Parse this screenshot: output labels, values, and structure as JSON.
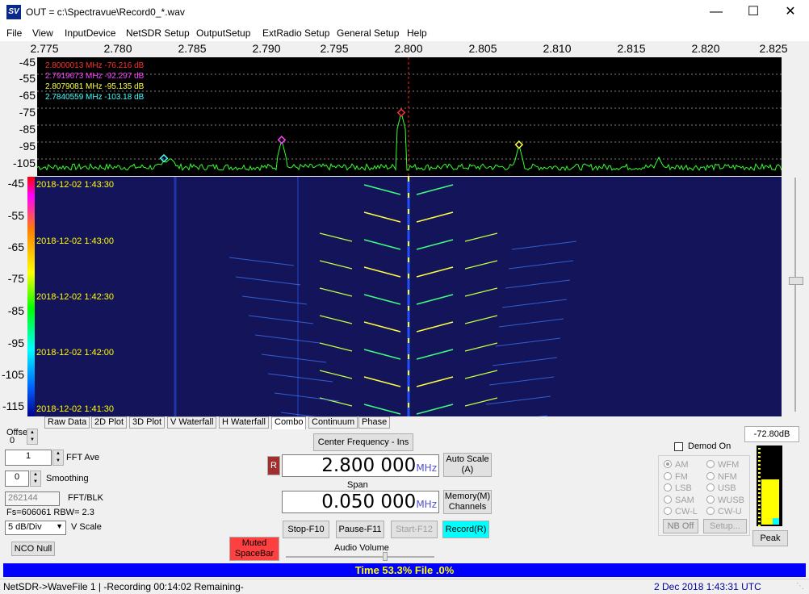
{
  "window": {
    "title": "OUT = c:\\Spectravue\\Record0_*.wav",
    "icon": "spectravue-app-icon",
    "icon_text": "SV"
  },
  "menu": [
    "File",
    "View",
    "InputDevice",
    "NetSDR Setup",
    "OutputSetup",
    "ExtRadio Setup",
    "General Setup",
    "Help"
  ],
  "freq_axis": {
    "ticks": [
      "2.775",
      "2.780",
      "2.785",
      "2.790",
      "2.795",
      "2.800",
      "2.805",
      "2.810",
      "2.815",
      "2.820",
      "2.825"
    ]
  },
  "spectrum": {
    "db_labels": [
      "-45",
      "-55",
      "-65",
      "-75",
      "-85",
      "-95",
      "-105"
    ],
    "markers": [
      {
        "text": "2.8000013 MHz  -76.216 dB",
        "color": "#ff3030",
        "freq": 2.8000013,
        "db": -76.216
      },
      {
        "text": "2.7919673 MHz  -92.297 dB",
        "color": "#ff40ff",
        "freq": 2.7919673,
        "db": -92.297
      },
      {
        "text": "2.8079081 MHz  -95.135 dB",
        "color": "#ffff40",
        "freq": 2.8079081,
        "db": -95.135
      },
      {
        "text": "2.7840559 MHz  -103.18 dB",
        "color": "#40ffff",
        "freq": 2.7840559,
        "db": -103.18
      }
    ]
  },
  "waterfall": {
    "db_labels": [
      "-45",
      "-55",
      "-65",
      "-75",
      "-85",
      "-95",
      "-105",
      "-115"
    ],
    "timestamps": [
      "2018-12-02 1:43:30",
      "2018-12-02 1:43:00",
      "2018-12-02 1:42:30",
      "2018-12-02 1:42:00",
      "2018-12-02 1:41:30"
    ]
  },
  "tabs": [
    {
      "label": "Raw Data",
      "active": false
    },
    {
      "label": "2D Plot",
      "active": false
    },
    {
      "label": "3D Plot",
      "active": false
    },
    {
      "label": "V Waterfall",
      "active": false
    },
    {
      "label": "H Waterfall",
      "active": false
    },
    {
      "label": "Combo",
      "active": true
    },
    {
      "label": "Continuum",
      "active": false
    },
    {
      "label": "Phase",
      "active": false
    }
  ],
  "controls": {
    "offset_label": "Offset",
    "offset_value": "0",
    "fft_ave_value": "1",
    "fft_ave_label": "FFT Ave",
    "smoothing_value": "0",
    "smoothing_label": "Smoothing",
    "fft_blk_value": "262144",
    "fft_blk_label": "FFT/BLK",
    "fs_text": "Fs=606061 RBW= 2.3",
    "vscale_value": "5 dB/Div",
    "vscale_label": "V Scale",
    "nco_null": "NCO Null",
    "muted_button": "Muted\nSpaceBar",
    "center_freq_button": "Center Frequency - Ins",
    "r_button": "R",
    "center_freq_value": "2.800 000",
    "center_freq_unit": "MHz",
    "auto_scale": "Auto Scale\n(A)",
    "span_label": "Span",
    "span_value": "0.050 000",
    "span_unit": "MHz",
    "memory_channels": "Memory(M)\nChannels",
    "stop": "Stop-F10",
    "pause": "Pause-F11",
    "start": "Start-F12",
    "record": "Record(R)",
    "audio_volume_label": "Audio Volume",
    "audio_volume_level": 0.67,
    "demod_on_label": "Demod On",
    "demod_modes": [
      [
        "AM",
        "WFM"
      ],
      [
        "FM",
        "NFM"
      ],
      [
        "LSB",
        "USB"
      ],
      [
        "SAM",
        "WUSB"
      ],
      [
        "CW-L",
        "CW-U"
      ]
    ],
    "demod_selected": "AM",
    "nb_off": "NB Off",
    "setup": "Setup...",
    "level_value": "-72.80dB",
    "level_fraction": 0.58,
    "peak": "Peak"
  },
  "progress": {
    "text": "Time 53.3%   File .0%"
  },
  "status": {
    "left": "NetSDR->WaveFile 1  | -Recording 00:14:02 Remaining-",
    "right": "2 Dec 2018   1:43:31 UTC"
  },
  "colors": {
    "accent": "#0000ff",
    "record": "#00ffff",
    "muted": "#ff4040",
    "trace": "#30ff30"
  }
}
